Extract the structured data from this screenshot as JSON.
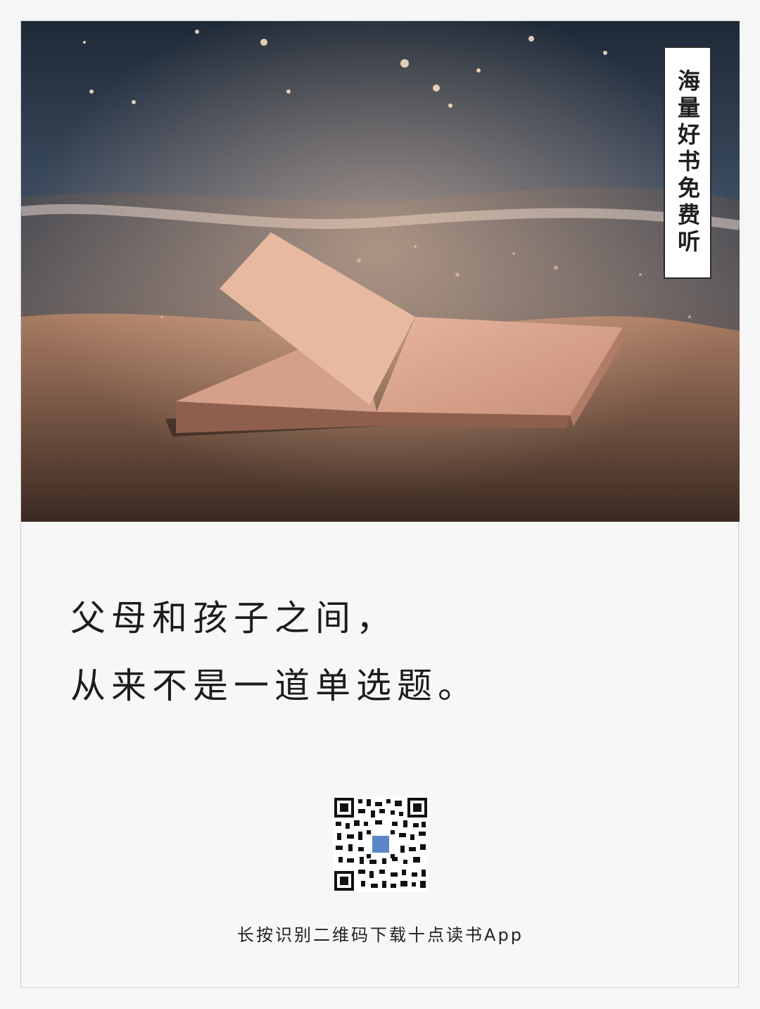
{
  "badge": {
    "text": "海量好书免费听"
  },
  "quote": {
    "line1": "父母和孩子之间，",
    "line2": "从来不是一道单选题。"
  },
  "qr": {
    "icon": "qr-code-icon"
  },
  "caption": {
    "text": "长按识别二维码下载十点读书App"
  },
  "colors": {
    "page_background": "#f8f7f8",
    "text": "#1c1c1c",
    "badge_border": "#2b2b2b",
    "logo_blue": "#5b87c7"
  }
}
